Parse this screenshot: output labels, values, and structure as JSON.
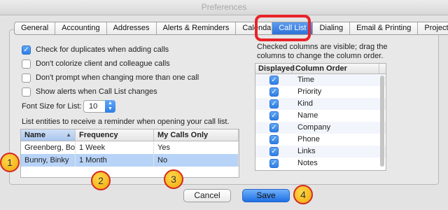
{
  "window": {
    "title": "Preferences"
  },
  "tabs": [
    {
      "label": "General"
    },
    {
      "label": "Accounting"
    },
    {
      "label": "Addresses"
    },
    {
      "label": "Alerts & Reminders"
    },
    {
      "label": "Calendar"
    },
    {
      "label": "Call List",
      "active": true
    },
    {
      "label": "Dialing"
    },
    {
      "label": "Email & Printing"
    },
    {
      "label": "Projects"
    }
  ],
  "options": [
    {
      "label": "Check for duplicates when adding calls",
      "checked": true
    },
    {
      "label": "Don't colorize client and colleague calls",
      "checked": false
    },
    {
      "label": "Don't prompt when changing more than one call",
      "checked": false
    },
    {
      "label": "Show alerts when Call List changes",
      "checked": false
    }
  ],
  "font_size": {
    "label": "Font Size for List:",
    "value": "10"
  },
  "reminder_list": {
    "caption": "List entities to receive a reminder when opening your call list.",
    "headers": [
      "Name",
      "Frequency",
      "My Calls Only"
    ],
    "rows": [
      [
        "Greenberg, Bobby",
        "1 Week",
        "Yes"
      ],
      [
        "Bunny, Binky",
        "1 Month",
        "No"
      ]
    ]
  },
  "columns_panel": {
    "caption_line1": "Checked columns are visible; drag the",
    "caption_line2": "columns to change the column order.",
    "headers": [
      "Displayed",
      "Column Order"
    ],
    "rows": [
      {
        "name": "Time",
        "displayed": true
      },
      {
        "name": "Priority",
        "displayed": true
      },
      {
        "name": "Kind",
        "displayed": true
      },
      {
        "name": "Name",
        "displayed": true
      },
      {
        "name": "Company",
        "displayed": true
      },
      {
        "name": "Phone",
        "displayed": true
      },
      {
        "name": "Links",
        "displayed": true
      },
      {
        "name": "Notes",
        "displayed": true
      }
    ]
  },
  "buttons": {
    "cancel": "Cancel",
    "save": "Save"
  },
  "markers": [
    "1",
    "2",
    "3",
    "4"
  ],
  "colors": {
    "accent": "#2f7fe6",
    "highlight": "#e8242a",
    "marker_fill": "#f5b81a"
  }
}
